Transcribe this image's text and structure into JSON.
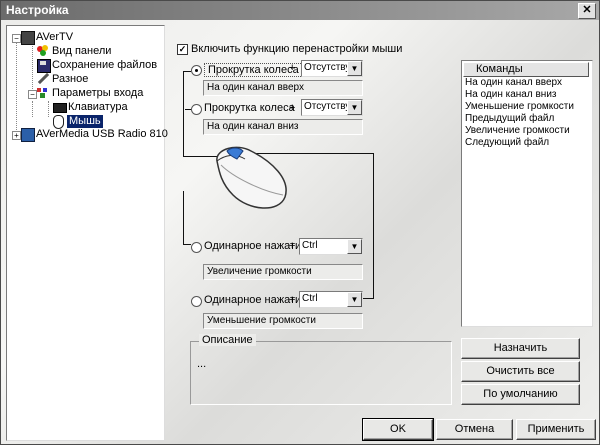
{
  "window": {
    "title": "Настройка",
    "close_glyph": "✕"
  },
  "tree": {
    "items": [
      {
        "label": "AVerTV",
        "icon": "tv-icon"
      },
      {
        "label": "Вид панели",
        "icon": "palette-icon"
      },
      {
        "label": "Сохранение файлов",
        "icon": "disk-icon"
      },
      {
        "label": "Разное",
        "icon": "wrench-icon"
      },
      {
        "label": "Параметры входа",
        "icon": "input-icon"
      },
      {
        "label": "Клавиатура",
        "icon": "keyboard-icon"
      },
      {
        "label": "Мышь",
        "icon": "mouse-icon",
        "selected": true
      },
      {
        "label": "AVerMedia USB Radio 810",
        "icon": "radio-icon"
      }
    ]
  },
  "main": {
    "enable_checkbox": {
      "label": "Включить функцию перенастройки мыши",
      "checked": true
    },
    "bindings": [
      {
        "action": "Прокрутка колеса",
        "plus": "+",
        "modifier": "Отсутству",
        "command": "На один канал вверх",
        "selected": true
      },
      {
        "action": "Прокрутка колеса",
        "plus": "+",
        "modifier": "Отсутству",
        "command": "На один канал вниз",
        "selected": false
      },
      {
        "action": "Одинарное нажати",
        "plus": "+",
        "modifier": "Ctrl",
        "command": "Увеличение громкости",
        "selected": false
      },
      {
        "action": "Одинарное нажати",
        "plus": "+",
        "modifier": "Ctrl",
        "command": "Уменьшение громкости",
        "selected": false
      }
    ],
    "commands": {
      "header": "Команды",
      "items": [
        "На один канал вверх",
        "На один канал вниз",
        "Уменьшение громкости",
        "Предыдущий файл",
        "Увеличение громкости",
        "Следующий файл"
      ]
    },
    "description": {
      "legend": "Описание",
      "text": "..."
    },
    "side_buttons": {
      "assign": "Назначить",
      "clear_all": "Очистить все",
      "defaults": "По умолчанию"
    }
  },
  "footer": {
    "ok": "OK",
    "cancel": "Отмена",
    "apply": "Применить"
  },
  "colors": {
    "selection": "#0a246a",
    "mouse_wheel": "#3a7bd5"
  }
}
